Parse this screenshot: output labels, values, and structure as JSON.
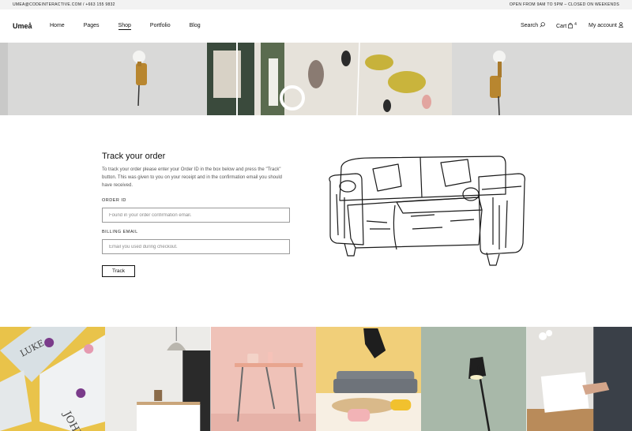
{
  "topbar": {
    "contact": "UMEA@CODEINTERACTIVE.COM / +663 155 9832",
    "hours": "OPEN FROM 9AM TO 5PM – CLOSED ON WEEKENDS"
  },
  "header": {
    "logo": "Umeå",
    "nav": [
      "Home",
      "Pages",
      "Shop",
      "Portfolio",
      "Blog"
    ],
    "active_nav": "Shop",
    "search_label": "Search",
    "cart_label": "Cart",
    "cart_count": "4",
    "account_label": "My account"
  },
  "main": {
    "title": "Track your order",
    "description": "To track your order please enter your Order ID in the box below and press the \"Track\" button. This was given to you on your receipt and in the confirmation email you should have received.",
    "order_id_label": "ORDER ID",
    "order_id_placeholder": "Found in your order confirmation email.",
    "billing_email_label": "BILLING EMAIL",
    "billing_email_placeholder": "Email you used during checkout.",
    "track_button": "Track"
  },
  "gallery": [
    "LUKE",
    "JOHN"
  ],
  "colors": {
    "topbar_bg": "#f2f2f2",
    "accent_text": "#111111",
    "field_border": "#9a9a9a"
  }
}
